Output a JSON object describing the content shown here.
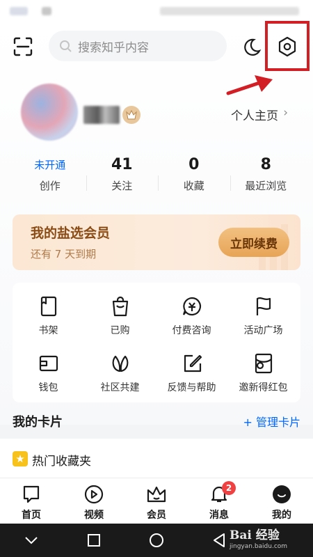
{
  "header": {
    "search_placeholder": "搜索知乎内容"
  },
  "profile": {
    "homepage_label": "个人主页",
    "homepage_chevron": "›"
  },
  "stats": [
    {
      "value": "未开通",
      "label": "创作"
    },
    {
      "value": "41",
      "label": "关注"
    },
    {
      "value": "0",
      "label": "收藏"
    },
    {
      "value": "8",
      "label": "最近浏览"
    }
  ],
  "vip": {
    "title": "我的盐选会员",
    "subtitle": "还有 7 天到期",
    "renew_label": "立即续费"
  },
  "shortcuts": [
    {
      "label": "书架",
      "icon": "bookshelf-icon"
    },
    {
      "label": "已购",
      "icon": "shopping-bag-icon"
    },
    {
      "label": "付费咨询",
      "icon": "paid-consult-icon"
    },
    {
      "label": "活动广场",
      "icon": "flag-icon"
    },
    {
      "label": "钱包",
      "icon": "wallet-icon"
    },
    {
      "label": "社区共建",
      "icon": "leaf-icon"
    },
    {
      "label": "反馈与帮助",
      "icon": "edit-icon"
    },
    {
      "label": "邀新得红包",
      "icon": "red-packet-icon"
    }
  ],
  "cards": {
    "title": "我的卡片",
    "manage_label": "+ 管理卡片",
    "favorite_folder": "热门收藏夹"
  },
  "tabs": [
    {
      "label": "首页",
      "icon": "home-icon"
    },
    {
      "label": "视频",
      "icon": "video-icon"
    },
    {
      "label": "会员",
      "icon": "crown-icon"
    },
    {
      "label": "消息",
      "icon": "bell-icon",
      "badge": "2"
    },
    {
      "label": "我的",
      "icon": "profile-icon"
    }
  ],
  "watermark": {
    "brand": "Bai 经验",
    "url": "jingyan.baidu.com"
  },
  "colors": {
    "accent_blue": "#0066ff",
    "highlight_red": "#d21f25",
    "vip_gold": "#e7a456",
    "badge_red": "#f04142"
  }
}
